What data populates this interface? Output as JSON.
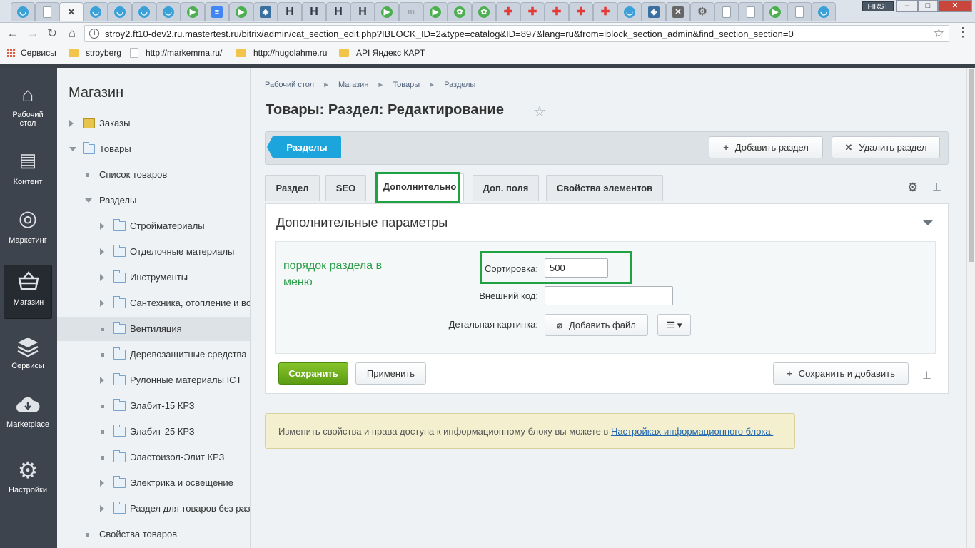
{
  "browser": {
    "tab_favicons": [
      {
        "icon": "basket-icon",
        "color": "#3aa0d8"
      },
      {
        "icon": "page-icon",
        "color": "#9aa3ab"
      },
      {
        "icon": "close-icon",
        "color": "#444444"
      },
      {
        "icon": "basket-icon",
        "color": "#3aa0d8"
      },
      {
        "icon": "basket-icon",
        "color": "#3aa0d8"
      },
      {
        "icon": "basket-icon",
        "color": "#3aa0d8"
      },
      {
        "icon": "basket-icon",
        "color": "#3aa0d8"
      },
      {
        "icon": "play-icon",
        "color": "#4caf50"
      },
      {
        "icon": "docs-icon",
        "color": "#4285f4"
      },
      {
        "icon": "play-icon",
        "color": "#4caf50"
      },
      {
        "icon": "layers-icon",
        "color": "#3b6fa0"
      },
      {
        "icon": "h-icon",
        "color": "#2f3b48"
      },
      {
        "icon": "h-icon",
        "color": "#2f3b48"
      },
      {
        "icon": "h-icon",
        "color": "#2f3b48"
      },
      {
        "icon": "h-icon",
        "color": "#2f3b48"
      },
      {
        "icon": "play-icon",
        "color": "#4caf50"
      },
      {
        "icon": "m-icon",
        "color": "#9aa3ab"
      },
      {
        "icon": "play-icon",
        "color": "#4caf50"
      },
      {
        "icon": "brain-icon",
        "color": "#4caf50"
      },
      {
        "icon": "brain-icon",
        "color": "#4caf50"
      },
      {
        "icon": "cross-icon",
        "color": "#e53935"
      },
      {
        "icon": "cross-icon",
        "color": "#e53935"
      },
      {
        "icon": "cross-icon",
        "color": "#e53935"
      },
      {
        "icon": "cross-icon",
        "color": "#e53935"
      },
      {
        "icon": "cross-icon",
        "color": "#e53935"
      },
      {
        "icon": "basket-icon",
        "color": "#3aa0d8"
      },
      {
        "icon": "layers-icon",
        "color": "#3b6fa0"
      },
      {
        "icon": "x-icon",
        "color": "#666666"
      },
      {
        "icon": "gear-icon",
        "color": "#666666"
      },
      {
        "icon": "page-icon",
        "color": "#9aa3ab"
      },
      {
        "icon": "page-icon",
        "color": "#9aa3ab"
      },
      {
        "icon": "play-icon",
        "color": "#4caf50"
      },
      {
        "icon": "page-icon",
        "color": "#9aa3ab"
      },
      {
        "icon": "basket-icon",
        "color": "#3aa0d8"
      }
    ],
    "profile_badge": "FIRST",
    "url": "stroy2.ft10-dev2.ru.mastertest.ru/bitrix/admin/cat_section_edit.php?IBLOCK_ID=2&type=catalog&ID=897&lang=ru&from=iblock_section_admin&find_section_section=0",
    "bookmarks": [
      "Сервисы",
      "stroyberg",
      "http://markemma.ru/",
      "http://hugolahme.ru",
      "API Яндекс КАРТ"
    ]
  },
  "sidebar": {
    "items": [
      {
        "label_1": "Рабочий",
        "label_2": "стол",
        "icon": "home-icon"
      },
      {
        "label_1": "Контент",
        "label_2": "",
        "icon": "document-icon"
      },
      {
        "label_1": "Маркетинг",
        "label_2": "",
        "icon": "target-icon"
      },
      {
        "label_1": "Магазин",
        "label_2": "",
        "icon": "basket-icon",
        "active": true
      },
      {
        "label_1": "Сервисы",
        "label_2": "",
        "icon": "layers-icon"
      },
      {
        "label_1": "Marketplace",
        "label_2": "",
        "icon": "cloud-download-icon"
      },
      {
        "label_1": "Настройки",
        "label_2": "",
        "icon": "gear-icon"
      }
    ]
  },
  "tree": {
    "title": "Магазин",
    "items": [
      {
        "label": "Заказы",
        "level": 0,
        "arrow": "right",
        "icon": "orders-icon"
      },
      {
        "label": "Товары",
        "level": 0,
        "arrow": "down",
        "icon": "folder-icon"
      },
      {
        "label": "Список товаров",
        "level": 1,
        "arrow": "dot",
        "icon": "none"
      },
      {
        "label": "Разделы",
        "level": 1,
        "arrow": "down",
        "icon": "none"
      },
      {
        "label": "Стройматериалы",
        "level": 2,
        "arrow": "right",
        "icon": "folder-icon"
      },
      {
        "label": "Отделочные материалы",
        "level": 2,
        "arrow": "right",
        "icon": "folder-icon"
      },
      {
        "label": "Инструменты",
        "level": 2,
        "arrow": "right",
        "icon": "folder-icon"
      },
      {
        "label": "Сантехника, отопление и во",
        "level": 2,
        "arrow": "right",
        "icon": "folder-icon"
      },
      {
        "label": "Вентиляция",
        "level": 2,
        "arrow": "dot",
        "icon": "folder-icon",
        "selected": true
      },
      {
        "label": "Деревозащитные средства",
        "level": 2,
        "arrow": "dot",
        "icon": "folder-icon"
      },
      {
        "label": "Рулонные материалы ICT",
        "level": 2,
        "arrow": "right",
        "icon": "folder-icon"
      },
      {
        "label": "Элабит-15 КРЗ",
        "level": 2,
        "arrow": "dot",
        "icon": "folder-icon"
      },
      {
        "label": "Элабит-25 КРЗ",
        "level": 2,
        "arrow": "dot",
        "icon": "folder-icon"
      },
      {
        "label": "Эластоизол-Элит КРЗ",
        "level": 2,
        "arrow": "dot",
        "icon": "folder-icon"
      },
      {
        "label": "Электрика и освещение",
        "level": 2,
        "arrow": "right",
        "icon": "folder-icon"
      },
      {
        "label": "Раздел для товаров без раз",
        "level": 2,
        "arrow": "right",
        "icon": "folder-icon"
      },
      {
        "label": "Свойства товаров",
        "level": 1,
        "arrow": "dot",
        "icon": "none"
      }
    ]
  },
  "breadcrumb": [
    "Рабочий стол",
    "Магазин",
    "Товары",
    "Разделы"
  ],
  "page_title": "Товары: Раздел: Редактирование",
  "actions": {
    "sections": "Разделы",
    "add_section": "Добавить раздел",
    "delete_section": "Удалить раздел"
  },
  "tabs": [
    {
      "label": "Раздел"
    },
    {
      "label": "SEO"
    },
    {
      "label": "Дополнительно",
      "active": true
    },
    {
      "label": "Доп. поля"
    },
    {
      "label": "Свойства элементов"
    }
  ],
  "panel": {
    "title": "Дополнительные параметры",
    "note": "порядок раздела в меню",
    "sort_label": "Сортировка:",
    "sort_value": "500",
    "external_code_label": "Внешний код:",
    "external_code_value": "",
    "detail_picture_label": "Детальная картинка:",
    "add_file": "Добавить файл"
  },
  "form_buttons": {
    "save": "Сохранить",
    "apply": "Применить",
    "save_and_add": "Сохранить и добавить"
  },
  "info": {
    "text": "Изменить свойства и права доступа к информационному блоку вы можете в ",
    "link": "Настройках информационного блока."
  },
  "colors": {
    "highlight": "#1fa242",
    "accent_blue": "#1ba5dc",
    "save_green": "#6aad1c"
  }
}
